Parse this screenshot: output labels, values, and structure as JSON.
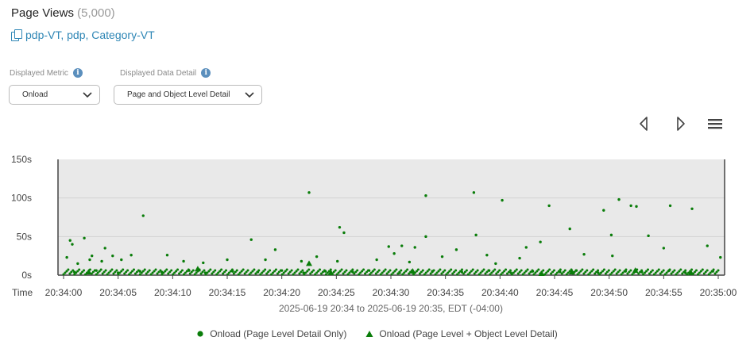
{
  "header": {
    "title": "Page Views",
    "count": "(5,000)",
    "pages_link": "pdp-VT, pdp, Category-VT"
  },
  "controls": {
    "metric_label": "Displayed Metric",
    "metric_value": "Onload",
    "detail_label": "Displayed Data Detail",
    "detail_value": "Page and Object Level Detail",
    "info_symbol": "i"
  },
  "toolbar": {
    "prev_icon": "chevron-left-icon",
    "next_icon": "chevron-right-icon",
    "menu_icon": "hamburger-menu-icon"
  },
  "colors": {
    "series": "#0a7d0a",
    "plot_background": "#e9e9e9",
    "link": "#2e86b5"
  },
  "chart_data": {
    "type": "scatter",
    "x_axis_title": "Time",
    "date_range_label": "2025-06-19 20:34 to 2025-06-19 20:35, EDT (-04:00)",
    "x_tick_labels": [
      "20:34:00",
      "20:34:05",
      "20:34:10",
      "20:34:15",
      "20:34:20",
      "20:34:25",
      "20:34:30",
      "20:34:35",
      "20:34:40",
      "20:34:45",
      "20:34:50",
      "20:34:55",
      "20:35:00"
    ],
    "xlim": [
      "20:34:00",
      "20:35:00"
    ],
    "y_tick_labels": [
      "0s",
      "50s",
      "100s",
      "150s"
    ],
    "ylim": [
      0,
      150
    ],
    "grid": true,
    "legend_position": "bottom",
    "series": [
      {
        "name": "Onload (Page Level Detail Only)",
        "marker": "circle",
        "points": [
          [
            "20:34:00.3",
            23
          ],
          [
            "20:34:00.6",
            45
          ],
          [
            "20:34:00.8",
            40
          ],
          [
            "20:34:01.3",
            15
          ],
          [
            "20:34:01.9",
            48
          ],
          [
            "20:34:02.4",
            20
          ],
          [
            "20:34:02.6",
            25
          ],
          [
            "20:34:03.5",
            18
          ],
          [
            "20:34:03.8",
            35
          ],
          [
            "20:34:04.5",
            25
          ],
          [
            "20:34:05.3",
            20
          ],
          [
            "20:34:06.2",
            26
          ],
          [
            "20:34:07.3",
            77
          ],
          [
            "20:34:09.5",
            26
          ],
          [
            "20:34:11.0",
            18
          ],
          [
            "20:34:12.8",
            16
          ],
          [
            "20:34:15.0",
            20
          ],
          [
            "20:34:17.2",
            46
          ],
          [
            "20:34:18.5",
            20
          ],
          [
            "20:34:19.4",
            33
          ],
          [
            "20:34:21.8",
            18
          ],
          [
            "20:34:22.5",
            107
          ],
          [
            "20:34:23.2",
            24
          ],
          [
            "20:34:25.1",
            18
          ],
          [
            "20:34:25.3",
            62
          ],
          [
            "20:34:25.7",
            55
          ],
          [
            "20:34:28.7",
            20
          ],
          [
            "20:34:29.8",
            37
          ],
          [
            "20:34:30.3",
            28
          ],
          [
            "20:34:31.0",
            38
          ],
          [
            "20:34:31.7",
            17
          ],
          [
            "20:34:32.2",
            36
          ],
          [
            "20:34:33.2",
            103
          ],
          [
            "20:34:33.2",
            50
          ],
          [
            "20:34:34.7",
            24
          ],
          [
            "20:34:36.0",
            33
          ],
          [
            "20:34:37.6",
            107
          ],
          [
            "20:34:37.8",
            52
          ],
          [
            "20:34:38.8",
            26
          ],
          [
            "20:34:39.6",
            15
          ],
          [
            "20:34:40.2",
            97
          ],
          [
            "20:34:41.8",
            22
          ],
          [
            "20:34:42.4",
            36
          ],
          [
            "20:34:43.7",
            43
          ],
          [
            "20:34:44.5",
            90
          ],
          [
            "20:34:46.4",
            60
          ],
          [
            "20:34:47.7",
            27
          ],
          [
            "20:34:49.5",
            84
          ],
          [
            "20:34:50.2",
            52
          ],
          [
            "20:34:50.3",
            25
          ],
          [
            "20:34:50.9",
            98
          ],
          [
            "20:34:52.0",
            90
          ],
          [
            "20:34:52.5",
            89
          ],
          [
            "20:34:53.6",
            51
          ],
          [
            "20:34:55.0",
            35
          ],
          [
            "20:34:55.6",
            90
          ],
          [
            "20:34:57.6",
            86
          ],
          [
            "20:34:59.0",
            38
          ],
          [
            "20:35:00.2",
            23
          ],
          [
            "20:34:01.0",
            4
          ],
          [
            "20:34:03.0",
            6
          ],
          [
            "20:34:05.0",
            3
          ],
          [
            "20:34:07.0",
            5
          ],
          [
            "20:34:09.0",
            4
          ],
          [
            "20:34:11.5",
            6
          ],
          [
            "20:34:13.0",
            3
          ],
          [
            "20:34:15.5",
            5
          ],
          [
            "20:34:17.8",
            4
          ],
          [
            "20:34:20.0",
            6
          ],
          [
            "20:34:22.0",
            3
          ],
          [
            "20:34:24.0",
            5
          ],
          [
            "20:34:26.5",
            4
          ],
          [
            "20:34:28.0",
            6
          ],
          [
            "20:34:30.8",
            3
          ],
          [
            "20:34:33.8",
            5
          ],
          [
            "20:34:36.5",
            4
          ],
          [
            "20:34:39.0",
            6
          ],
          [
            "20:34:41.0",
            3
          ],
          [
            "20:34:43.0",
            5
          ],
          [
            "20:34:45.5",
            4
          ],
          [
            "20:34:47.0",
            6
          ],
          [
            "20:34:49.0",
            3
          ],
          [
            "20:34:51.5",
            5
          ],
          [
            "20:34:53.0",
            4
          ],
          [
            "20:34:55.5",
            6
          ],
          [
            "20:34:57.0",
            3
          ],
          [
            "20:34:59.5",
            5
          ]
        ]
      },
      {
        "name": "Onload (Page Level + Object Level Detail)",
        "marker": "triangle",
        "points": [
          [
            "20:34:02.3",
            4
          ],
          [
            "20:34:12.3",
            8
          ],
          [
            "20:34:22.5",
            15
          ],
          [
            "20:34:24.5",
            3
          ],
          [
            "20:34:32.0",
            5
          ],
          [
            "20:34:43.8",
            2
          ],
          [
            "20:34:46.6",
            4
          ],
          [
            "20:34:52.4",
            6
          ],
          [
            "20:34:57.5",
            3
          ]
        ]
      }
    ]
  }
}
